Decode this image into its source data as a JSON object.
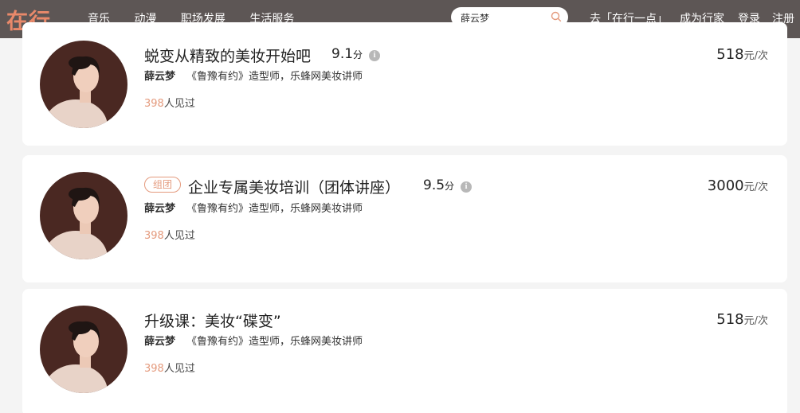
{
  "header": {
    "logo": "在行",
    "nav": [
      "音乐",
      "动漫",
      "职场发展",
      "生活服务"
    ],
    "search_value": "薛云梦",
    "goto_app": "去「在行一点」",
    "become_expert": "成为行家",
    "login": "登录",
    "register": "注册"
  },
  "courses": [
    {
      "title": "蜕变从精致的美妆开始吧",
      "score": "9.1",
      "score_unit": "分",
      "teacher_name": "薛云梦",
      "teacher_desc": "《鲁豫有约》造型师，乐蜂网美妆讲师",
      "seen_count": "398",
      "seen_label": "人见过",
      "price": "518",
      "price_unit": "元/次",
      "tag": ""
    },
    {
      "title": "企业专属美妆培训（团体讲座）",
      "score": "9.5",
      "score_unit": "分",
      "teacher_name": "薛云梦",
      "teacher_desc": "《鲁豫有约》造型师，乐蜂网美妆讲师",
      "seen_count": "398",
      "seen_label": "人见过",
      "price": "3000",
      "price_unit": "元/次",
      "tag": "组团"
    },
    {
      "title": "升级课：美妆“碟变”",
      "score": "",
      "score_unit": "",
      "teacher_name": "薛云梦",
      "teacher_desc": "《鲁豫有约》造型师，乐蜂网美妆讲师",
      "seen_count": "398",
      "seen_label": "人见过",
      "price": "518",
      "price_unit": "元/次",
      "tag": ""
    }
  ],
  "colors": {
    "header_bg": "#5d5655",
    "accent": "#e49a7d",
    "logo": "#e9896a"
  }
}
